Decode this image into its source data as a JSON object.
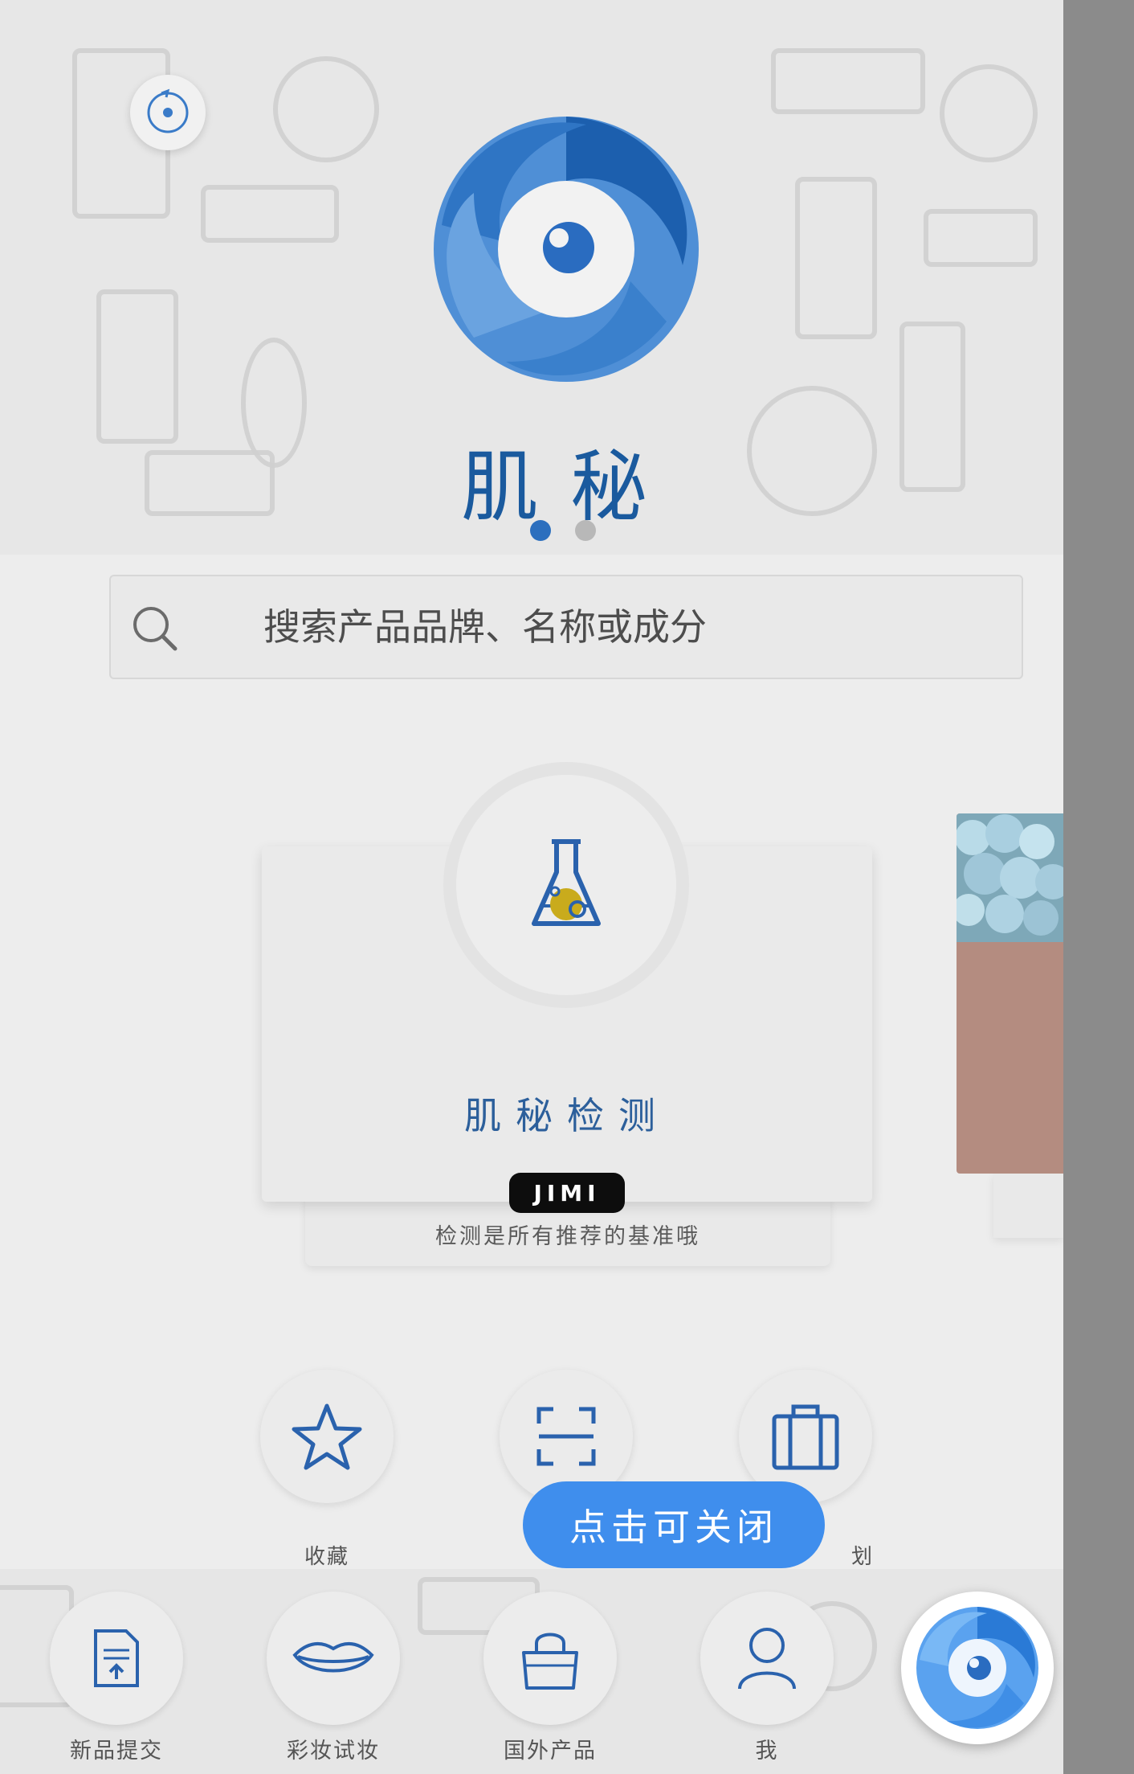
{
  "app": {
    "title": "肌秘"
  },
  "carousel": {
    "pages": 2,
    "active_index": 0
  },
  "search": {
    "placeholder": "搜索产品品牌、名称或成分"
  },
  "detect_card": {
    "title": "肌秘检测",
    "badge": "JIMI",
    "subtitle": "检测是所有推荐的基准哦"
  },
  "features": [
    {
      "label": "收藏",
      "icon": "star-icon"
    },
    {
      "label": "",
      "icon": "scan-icon"
    },
    {
      "label": "划",
      "icon": "suitcase-icon"
    }
  ],
  "toast": {
    "text": "点击可关闭"
  },
  "bottom_nav": [
    {
      "label": "新品提交",
      "icon": "document-upload-icon"
    },
    {
      "label": "彩妆试妆",
      "icon": "lips-icon"
    },
    {
      "label": "国外产品",
      "icon": "handbag-icon"
    },
    {
      "label": "我",
      "icon": "person-icon"
    }
  ],
  "colors": {
    "brand_blue": "#2c6fbe",
    "toast_blue": "#3f8eed",
    "title_blue": "#1a5a9e"
  }
}
